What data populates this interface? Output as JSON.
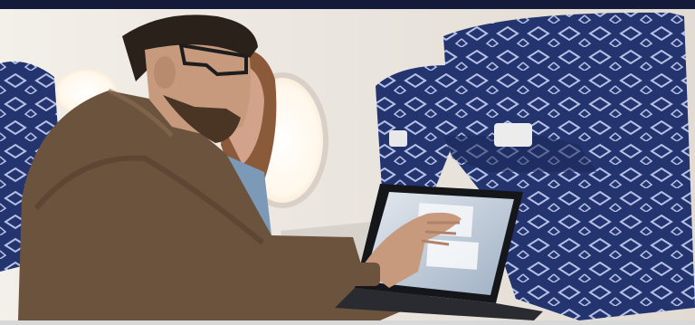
{
  "scene": {
    "subject": "photo",
    "colors": {
      "cabin_wall": "#e7e2dc",
      "seat_fabric": "#23346f",
      "seat_pattern": "#b7c1e6",
      "jacket": "#6b533d",
      "skin": "#c79a7e",
      "hair": "#2b211b",
      "window_glow": "#fff7ea",
      "laptop_frame": "#15161a",
      "screen": "#cfd6df"
    }
  }
}
